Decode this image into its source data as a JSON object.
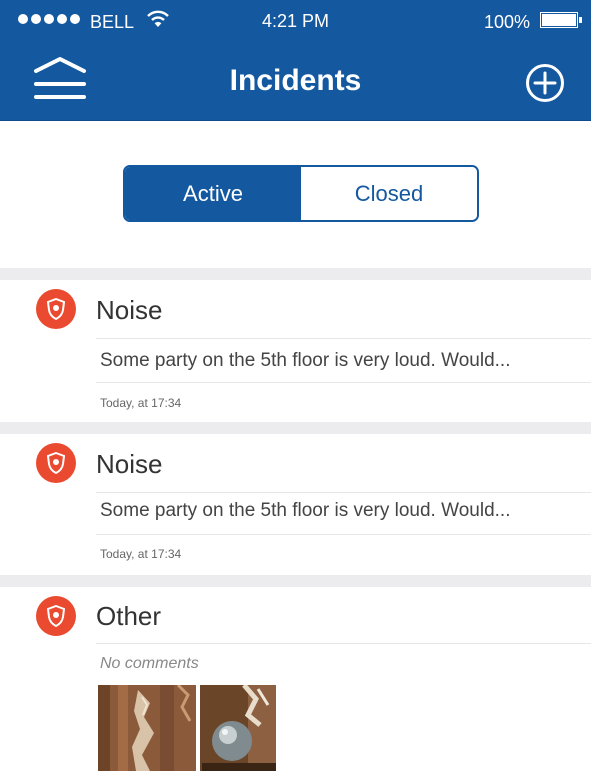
{
  "status_bar": {
    "carrier": "BELL",
    "time": "4:21 PM",
    "battery": "100%"
  },
  "header": {
    "title": "Incidents",
    "menu_icon": "menu-icon",
    "add_icon": "plus-circle-icon",
    "background": "#1458a0"
  },
  "filter": {
    "tabs": [
      {
        "label": "Active",
        "selected": true
      },
      {
        "label": "Closed",
        "selected": false
      }
    ]
  },
  "incidents": [
    {
      "category": "Noise",
      "description": "Some party on the 5th floor is very loud. Would...",
      "timestamp": "Today, at 17:34",
      "icon": "police-badge-icon"
    },
    {
      "category": "Noise",
      "description": "Some party on the 5th floor is very loud. Would...",
      "timestamp": "Today, at 17:34",
      "icon": "police-badge-icon"
    },
    {
      "category": "Other",
      "comment": "No comments",
      "icon": "police-badge-icon",
      "photos": [
        "broken-door-photo",
        "door-knob-photo"
      ]
    }
  ],
  "colors": {
    "brand_blue": "#1458a0",
    "badge_red": "#ea4a2f",
    "separator": "#ececee"
  }
}
